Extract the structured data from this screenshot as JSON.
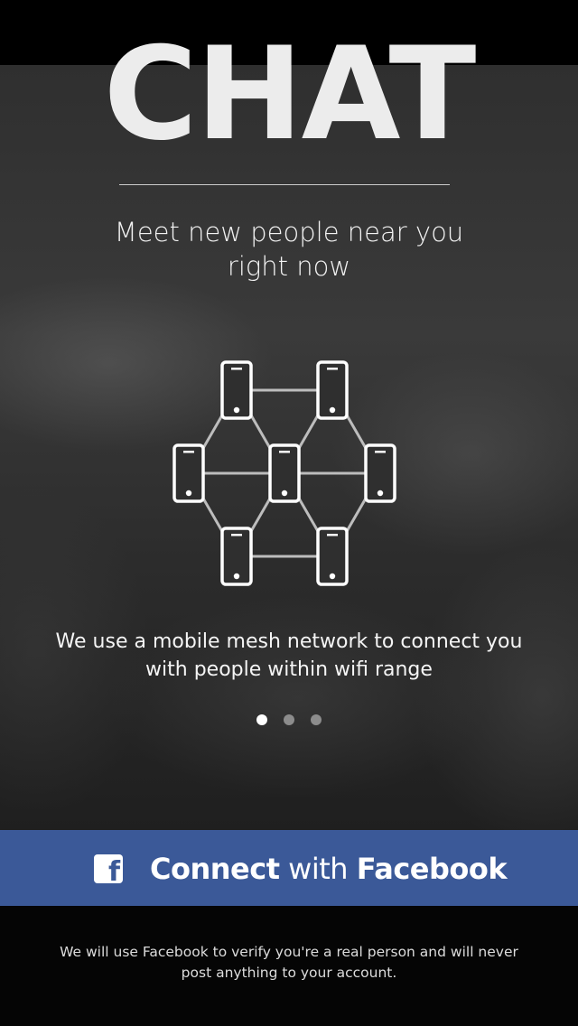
{
  "app": {
    "title": "CHAT"
  },
  "onboarding": {
    "tagline": "Meet new people near you right now",
    "description": "We use a mobile mesh network to connect you with people within wifi range",
    "page_count": 3,
    "active_page": 1
  },
  "login": {
    "button_label_part1": "Connect",
    "button_label_part2": " with ",
    "button_label_part3": "Facebook",
    "button_icon": "facebook-icon",
    "disclaimer": "We will use Facebook to verify you're a real person and will never post anything to your account."
  },
  "colors": {
    "facebook_blue": "#3b5998",
    "title_text": "#ececec",
    "dot_active": "#ffffff",
    "dot_inactive": "#8c8c8c"
  }
}
